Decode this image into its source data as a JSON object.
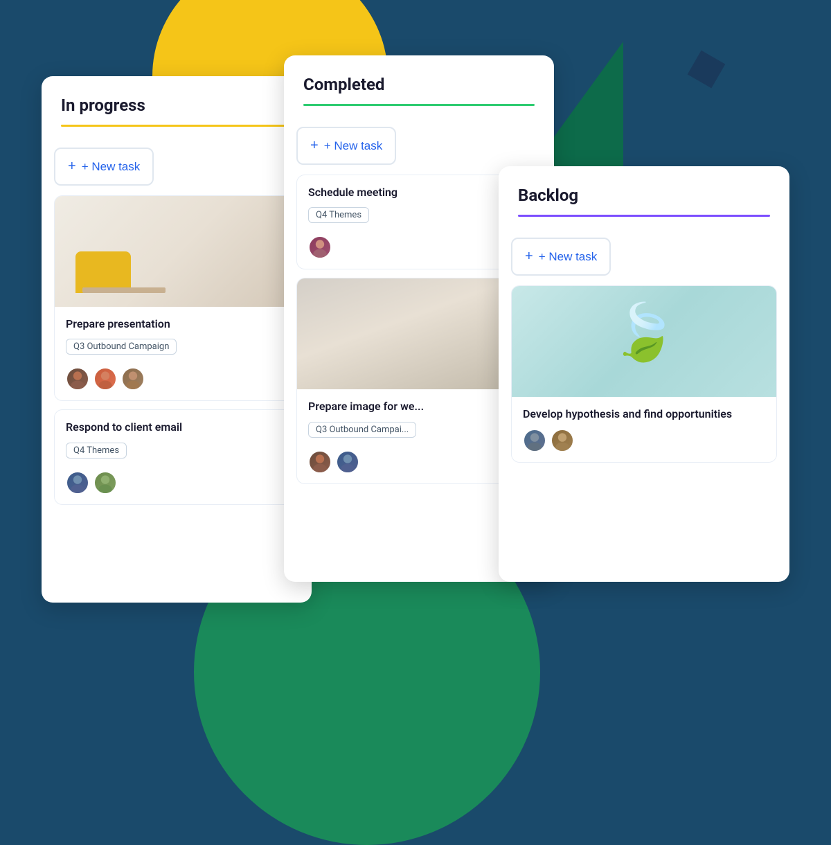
{
  "background": {
    "color": "#1a4a6b"
  },
  "columns": {
    "in_progress": {
      "title": "In progress",
      "underline_color": "#f5c518",
      "new_task_label": "+ New task",
      "tasks": [
        {
          "id": "task-1",
          "has_image": true,
          "image_type": "desk",
          "title": "Prepare presentation",
          "tag": "Q3 Outbound Campaign",
          "avatars": [
            "av-1",
            "av-2",
            "av-3"
          ]
        },
        {
          "id": "task-2",
          "has_image": false,
          "title": "Respond to client email",
          "tag": "Q4 Themes",
          "avatars": [
            "av-4",
            "av-5"
          ]
        }
      ]
    },
    "completed": {
      "title": "Completed",
      "underline_color": "#2ecc71",
      "new_task_label": "+ New task",
      "tasks": [
        {
          "id": "task-3",
          "has_image": false,
          "title": "Schedule meeting",
          "tag": "Q4 Themes",
          "avatars": [
            "av-6"
          ]
        },
        {
          "id": "task-4",
          "has_image": true,
          "image_type": "bedroom",
          "title": "Prepare image for we...",
          "tag": "Q3 Outbound Campai...",
          "avatars": [
            "av-1",
            "av-4"
          ]
        }
      ]
    },
    "backlog": {
      "title": "Backlog",
      "underline_color": "#7c4dff",
      "new_task_label": "+ New task",
      "tasks": [
        {
          "id": "task-5",
          "has_image": true,
          "image_type": "leaf",
          "title": "Develop hypothesis and find opportunities",
          "tag": null,
          "avatars": [
            "av-7",
            "av-8"
          ]
        }
      ]
    }
  }
}
